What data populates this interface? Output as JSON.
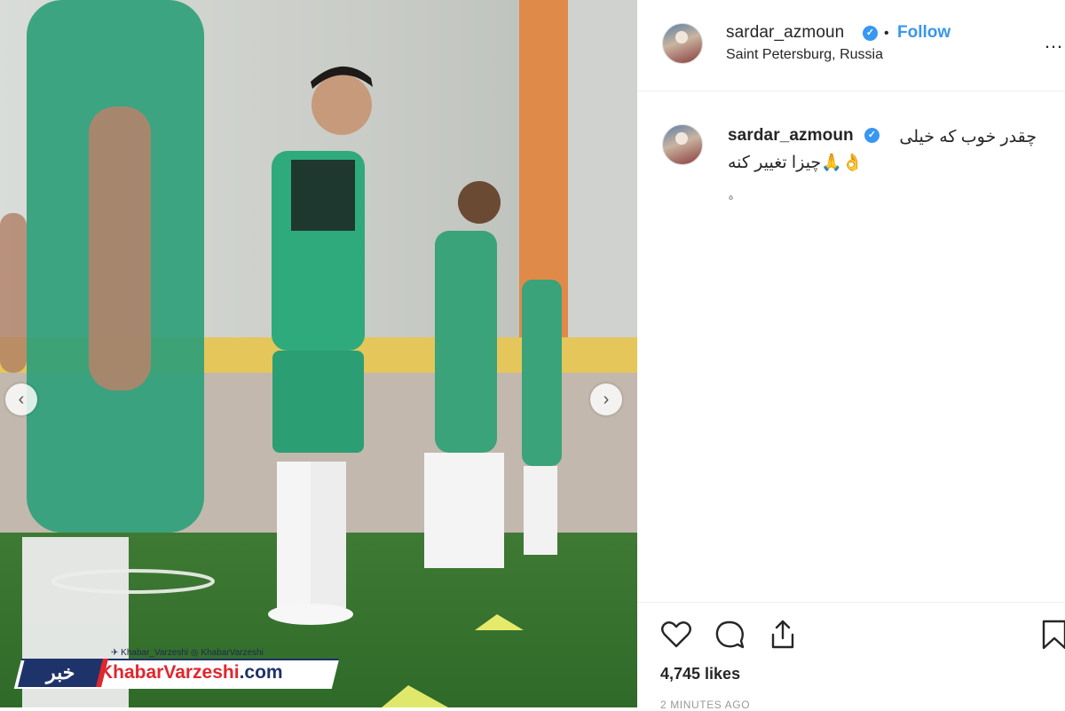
{
  "post": {
    "username": "sardar_azmoun",
    "dot": "•",
    "follow_label": "Follow",
    "location": "Saint Petersburg, Russia",
    "more_label": "…"
  },
  "comment": {
    "username": "sardar_azmoun",
    "line1": "چقدر خوب که خیلی",
    "line2": "👌🙏چیزا تغییر کنه",
    "line3": "ہ"
  },
  "engagement": {
    "likes": "4,745 likes",
    "time": "2 MINUTES AGO"
  },
  "watermark": {
    "handles": "✈ Khabar_Varzeshi  ◎ KhabarVarzeshi",
    "logo": "خبر",
    "name_main": "KhabarVarzeshi",
    "name_domain": ".com"
  },
  "icons": [
    "chevron-left-icon",
    "chevron-right-icon",
    "heart-icon",
    "comment-icon",
    "share-icon",
    "bookmark-icon",
    "verified-badge-icon"
  ],
  "colors": {
    "link": "#3897f0",
    "text": "#262626",
    "muted": "#999999",
    "brand_red": "#e1262d",
    "brand_navy": "#1e3369"
  }
}
